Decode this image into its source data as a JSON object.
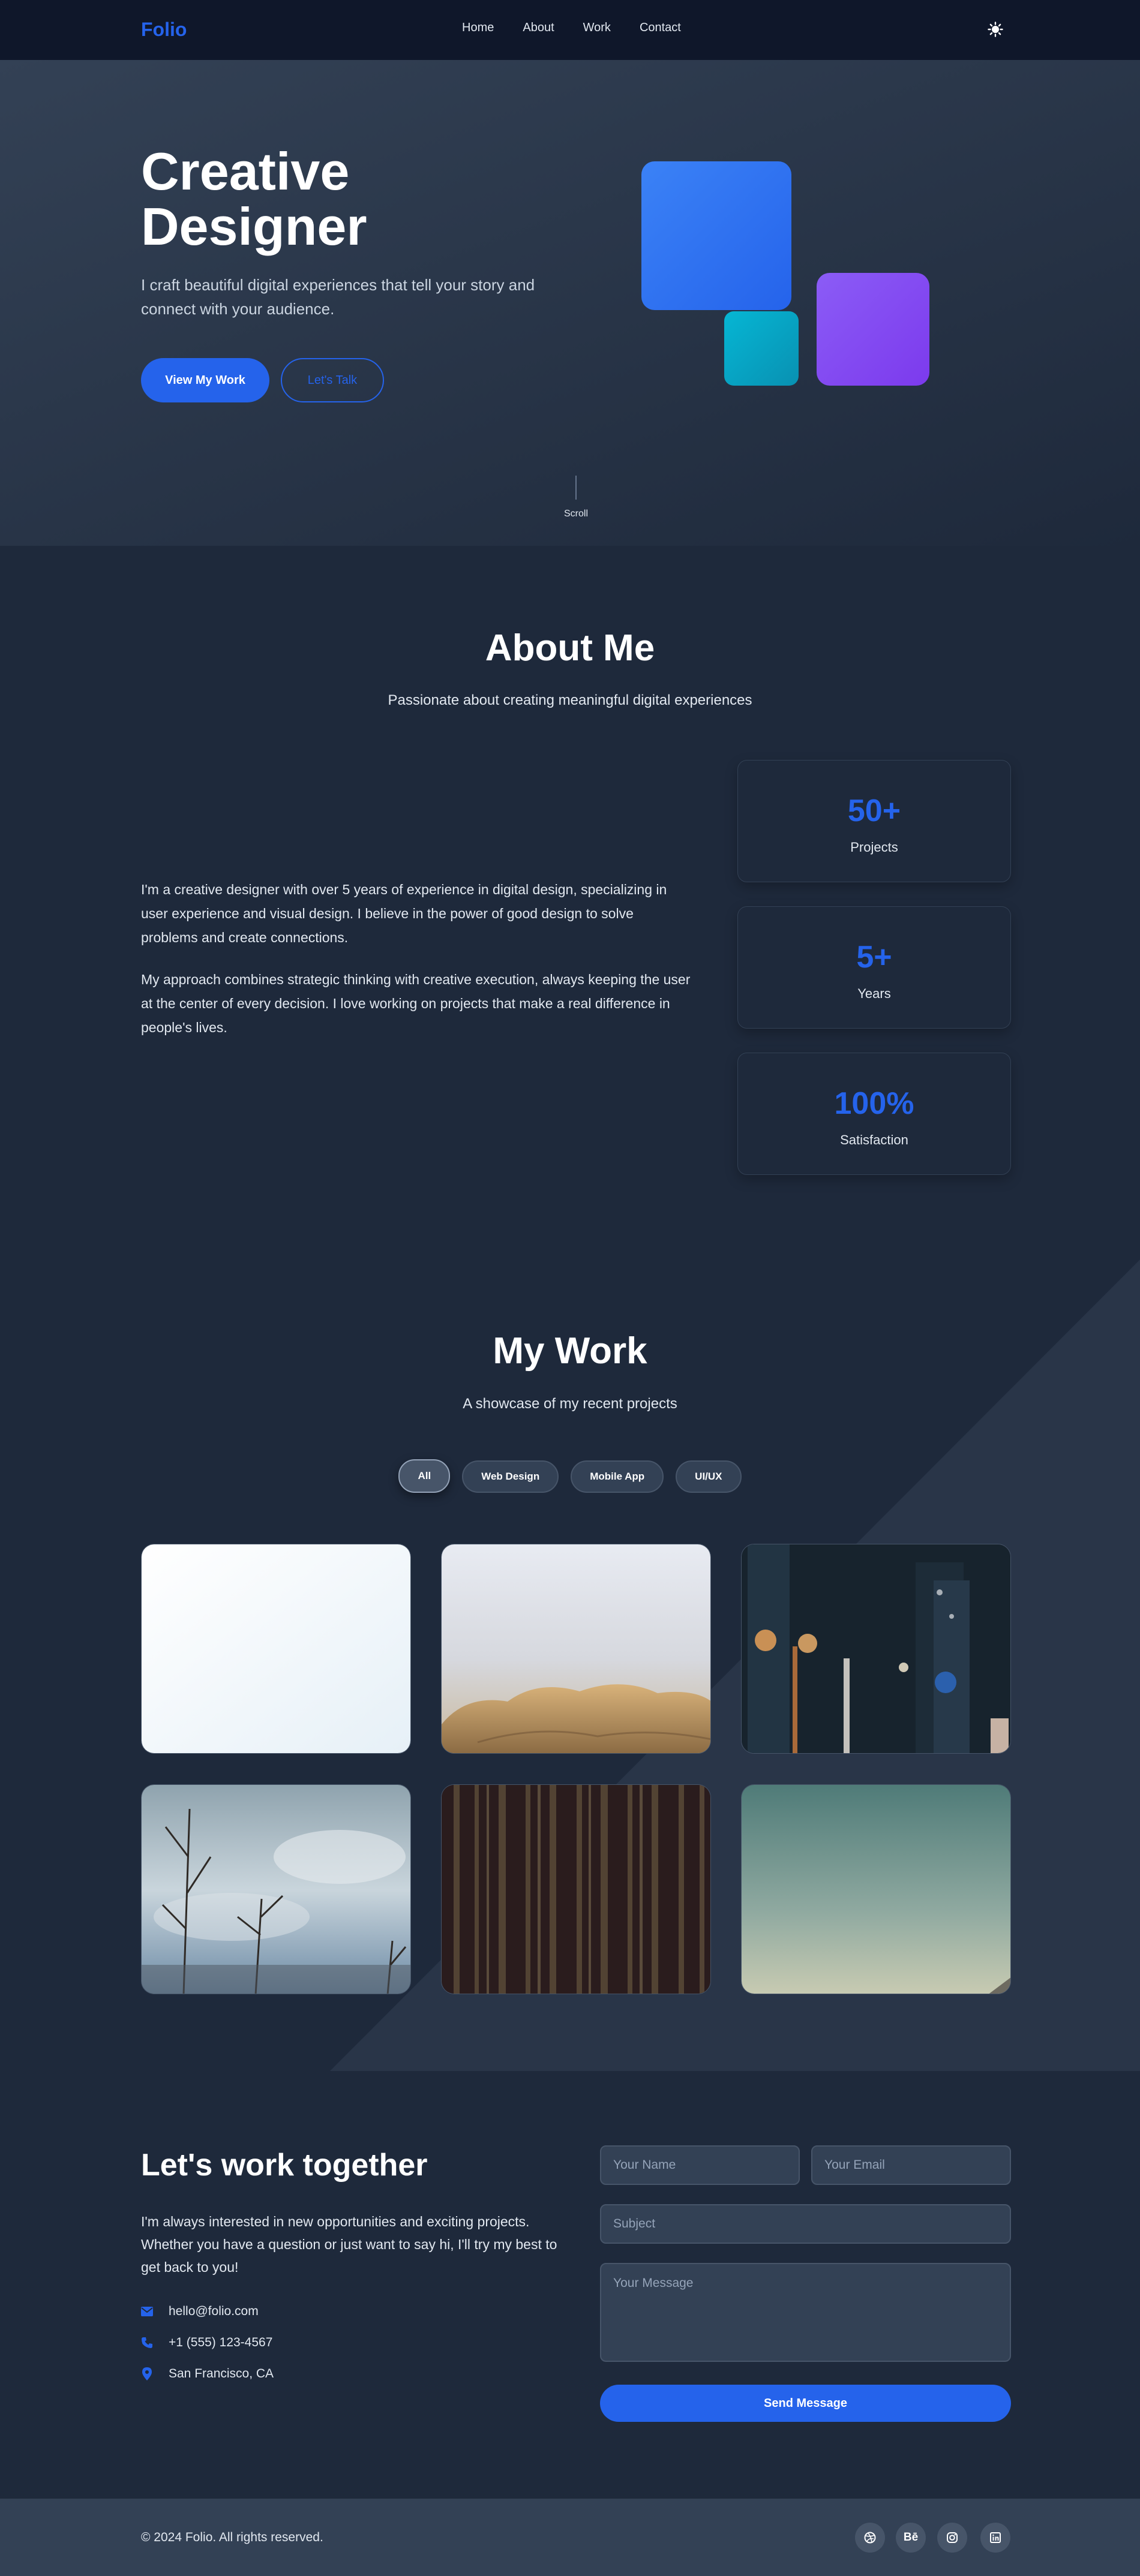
{
  "colors": {
    "accent": "#2563eb",
    "nav_bg": "#0f172a",
    "page_bg": "#1e293b",
    "footer_bg": "#334155",
    "shape_blue": "#3b82f6",
    "shape_cyan": "#06b6d4",
    "shape_purple": "#8b5cf6"
  },
  "nav": {
    "logo": "Folio",
    "links": [
      "Home",
      "About",
      "Work",
      "Contact"
    ],
    "theme_icon": "sun-icon"
  },
  "hero": {
    "title_line1": "Creative",
    "title_line2": "Designer",
    "subtitle": "I craft beautiful digital experiences that tell your story and connect with your audience.",
    "primary_button": "View My Work",
    "secondary_button": "Let's Talk",
    "scroll_label": "Scroll"
  },
  "about": {
    "title": "About Me",
    "subtitle": "Passionate about creating meaningful digital experiences",
    "paragraphs": [
      "I'm a creative designer with over 5 years of experience in digital design, specializing in user experience and visual design. I believe in the power of good design to solve problems and create connections.",
      "My approach combines strategic thinking with creative execution, always keeping the user at the center of every decision. I love working on projects that make a real difference in people's lives."
    ],
    "stats": [
      {
        "value": "50+",
        "label": "Projects"
      },
      {
        "value": "5+",
        "label": "Years"
      },
      {
        "value": "100%",
        "label": "Satisfaction"
      }
    ]
  },
  "work": {
    "title": "My Work",
    "subtitle": "A showcase of my recent projects",
    "filters": [
      "All",
      "Web Design",
      "Mobile App",
      "UI/UX"
    ],
    "active_filter": "All"
  },
  "contact": {
    "title": "Let's work together",
    "text": "I'm always interested in new opportunities and exciting projects. Whether you have a question or just want to say hi, I'll try my best to get back to you!",
    "email": "hello@folio.com",
    "phone": "+1 (555) 123-4567",
    "location": "San Francisco, CA",
    "form": {
      "name_placeholder": "Your Name",
      "email_placeholder": "Your Email",
      "subject_placeholder": "Subject",
      "message_placeholder": "Your Message",
      "submit": "Send Message"
    }
  },
  "footer": {
    "copyright": "© 2024 Folio. All rights reserved.",
    "social_icons": [
      "dribbble-icon",
      "behance-icon",
      "instagram-icon",
      "linkedin-icon"
    ],
    "behance_text": "Bē"
  }
}
